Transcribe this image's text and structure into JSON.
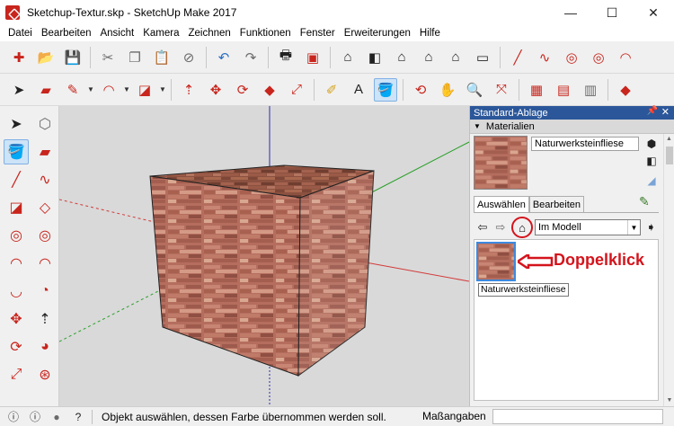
{
  "window": {
    "title": "Sketchup-Textur.skp - SketchUp Make 2017",
    "minimize": "—",
    "maximize": "☐",
    "close": "✕"
  },
  "menu": [
    "Datei",
    "Bearbeiten",
    "Ansicht",
    "Kamera",
    "Zeichnen",
    "Funktionen",
    "Fenster",
    "Erweiterungen",
    "Hilfe"
  ],
  "panel": {
    "title": "Standard-Ablage",
    "pin": "📌",
    "close": "✕",
    "section": "Materialien",
    "material_name": "Naturwerksteinfliese",
    "tabs": [
      "Auswählen",
      "Bearbeiten"
    ],
    "collection": "Im Modell",
    "swatch_tooltip": "Naturwerksteinfliese",
    "annotation": "Doppelklick"
  },
  "status": {
    "message": "Objekt auswählen, dessen Farbe übernommen werden soll.",
    "measure_label": "Maßangaben"
  },
  "colors": {
    "accent": "#d4141c",
    "panel_header": "#2b579a",
    "viewport_bg": "#d9d9d9",
    "brick": "#b06a5a"
  }
}
